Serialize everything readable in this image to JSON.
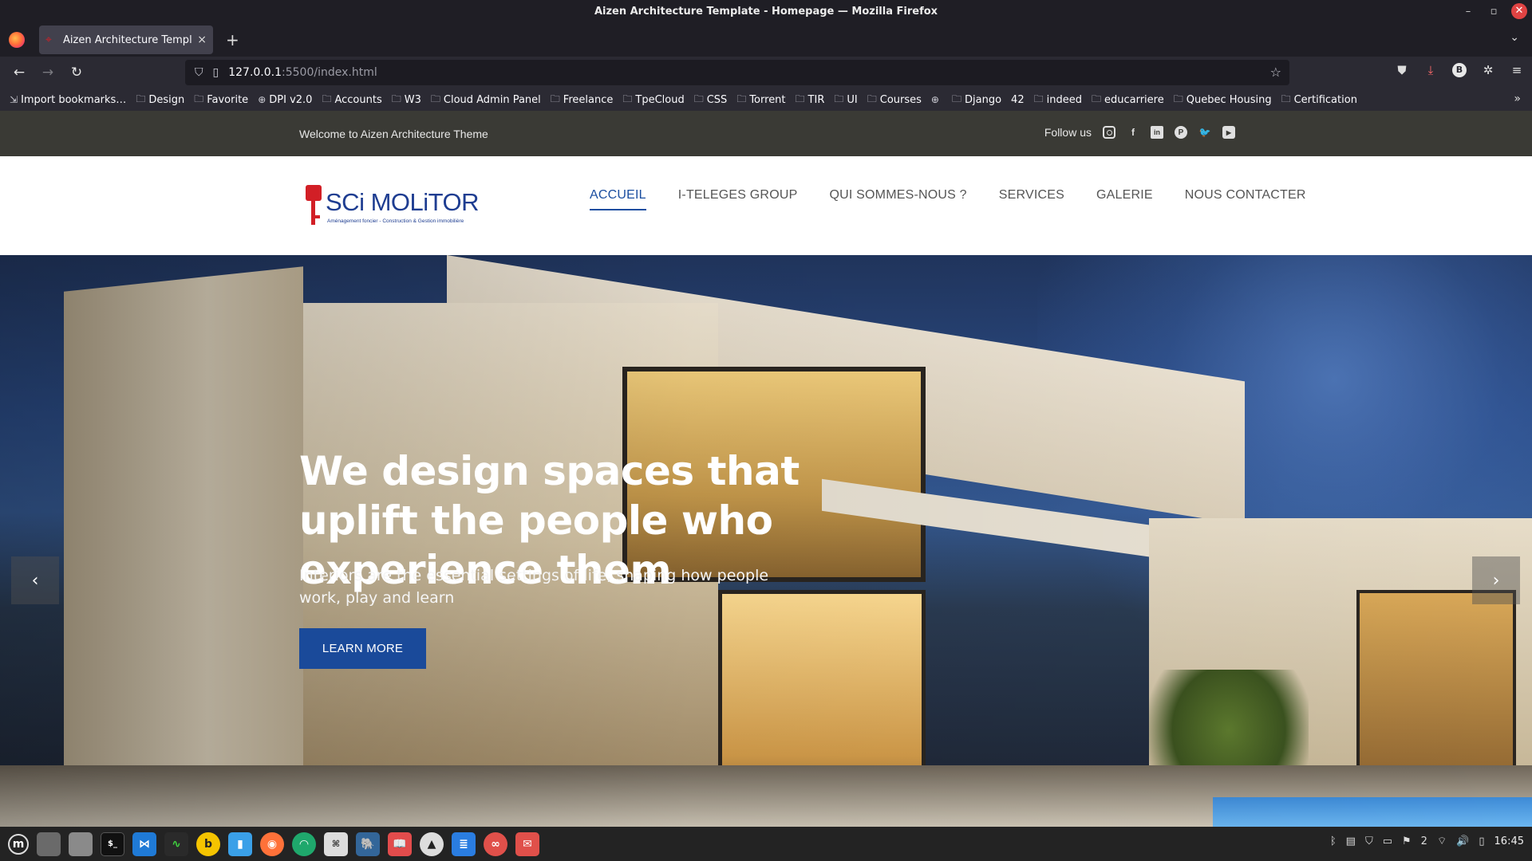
{
  "window": {
    "title": "Aizen Architecture Template - Homepage — Mozilla Firefox",
    "controls": [
      "–",
      "▫",
      "✕"
    ]
  },
  "tab": {
    "label": "Aizen Architecture Templat",
    "close": "×"
  },
  "newtab": "+",
  "address": {
    "host": "127.0.0.1",
    "path": ":5500/index.html"
  },
  "bookmarks": [
    {
      "label": "Import bookmarks…",
      "icon": "import-icon"
    },
    {
      "label": "Design",
      "icon": "folder-icon"
    },
    {
      "label": "Favorite",
      "icon": "folder-icon"
    },
    {
      "label": "DPI v2.0",
      "icon": "globe-icon"
    },
    {
      "label": "Accounts",
      "icon": "folder-icon"
    },
    {
      "label": "W3",
      "icon": "folder-icon"
    },
    {
      "label": "Cloud Admin Panel",
      "icon": "folder-icon"
    },
    {
      "label": "Freelance",
      "icon": "folder-icon"
    },
    {
      "label": "TpeCloud",
      "icon": "folder-icon"
    },
    {
      "label": "CSS",
      "icon": "folder-icon"
    },
    {
      "label": "Torrent",
      "icon": "folder-icon"
    },
    {
      "label": "TIR",
      "icon": "folder-icon"
    },
    {
      "label": "UI",
      "icon": "folder-icon"
    },
    {
      "label": "Courses",
      "icon": "folder-icon"
    },
    {
      "label": "",
      "icon": "globe-icon"
    },
    {
      "label": "Django",
      "icon": "folder-icon"
    },
    {
      "label": "42",
      "icon": "none"
    },
    {
      "label": "indeed",
      "icon": "folder-icon"
    },
    {
      "label": "educarriere",
      "icon": "folder-icon"
    },
    {
      "label": "Quebec Housing",
      "icon": "folder-icon"
    },
    {
      "label": "Certification",
      "icon": "folder-icon"
    }
  ],
  "site": {
    "welcome": "Welcome to Aizen Architecture Theme",
    "follow_label": "Follow us",
    "social": [
      "instagram-icon",
      "facebook-icon",
      "linkedin-icon",
      "pinterest-icon",
      "twitter-icon",
      "youtube-icon"
    ],
    "logo_text": "SCi MOLiTOR",
    "logo_sub": "Aménagement foncier - Construction & Gestion immobilière",
    "menu": [
      "ACCUEIL",
      "I-TELEGES GROUP",
      "QUI SOMMES-NOUS ?",
      "SERVICES",
      "GALERIE",
      "NOUS CONTACTER"
    ],
    "active_menu": "ACCUEIL",
    "hero": {
      "title": "We design spaces that uplift the people who experience them",
      "subtitle": "Interiors are the essential settings of life, shaping how people work, play and learn",
      "button": "LEARN MORE",
      "prev": "‹",
      "next": "›"
    }
  },
  "taskbar": {
    "apps": [
      "menu-icon",
      "desktop-icon",
      "files-icon",
      "terminal-icon",
      "vscode-icon",
      "monitor-icon",
      "bitwarden-icon",
      "notes-icon",
      "firefox-icon",
      "mint-icon",
      "grid-icon",
      "postgres-icon",
      "book-icon",
      "inkscape-icon",
      "text-editor-icon",
      "glasses-icon",
      "mail-icon"
    ],
    "tray_count": "2",
    "clock": "16:45"
  },
  "colors": {
    "brand_blue": "#1b4ea0",
    "brand_red": "#d21f26",
    "topbar_bg": "#3a3a35",
    "button_bg": "#1a4a9a"
  }
}
